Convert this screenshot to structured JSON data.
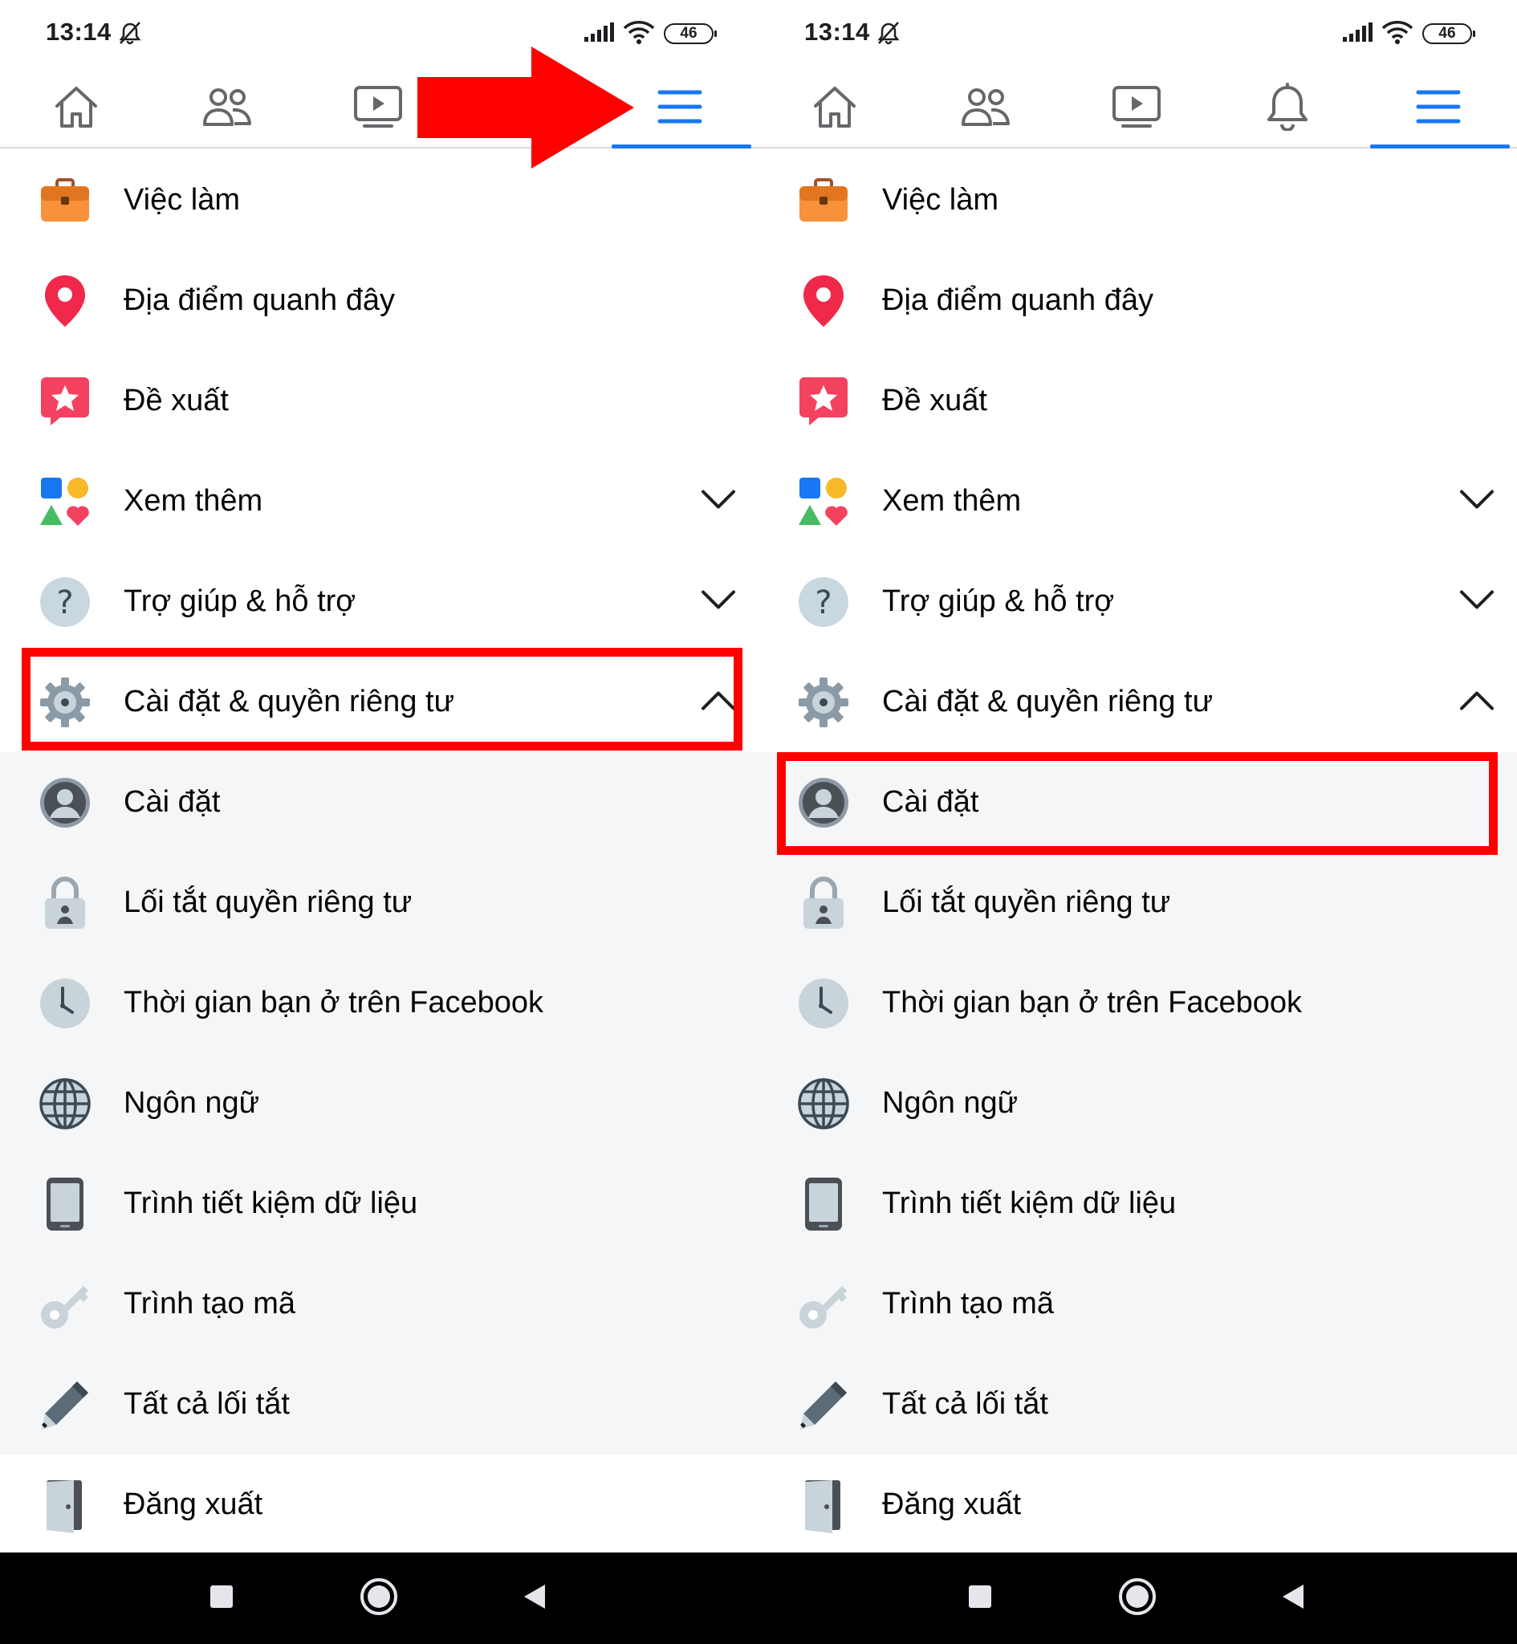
{
  "colors": {
    "accent": "#1877f2",
    "highlight": "#ff0000",
    "sub_bg": "#f5f6f8",
    "navbar": "#000000"
  },
  "status": {
    "time": "13:14",
    "battery": "46"
  },
  "tabs": [
    "home-icon",
    "friends-icon",
    "watch-icon",
    "notifications-icon",
    "menu-icon"
  ],
  "menu": {
    "jobs": "Việc làm",
    "nearby": "Địa điểm quanh đây",
    "recommendations": "Đề xuất",
    "see_more": "Xem thêm",
    "help": "Trợ giúp & hỗ trợ",
    "settings_privacy": "Cài đặt & quyền riêng tư",
    "settings": "Cài đặt",
    "privacy_shortcuts": "Lối tắt quyền riêng tư",
    "time_on_fb": "Thời gian bạn ở trên Facebook",
    "language": "Ngôn ngữ",
    "data_saver": "Trình tiết kiệm dữ liệu",
    "code_generator": "Trình tạo mã",
    "all_shortcuts": "Tất cả lối tắt",
    "logout": "Đăng xuất"
  }
}
